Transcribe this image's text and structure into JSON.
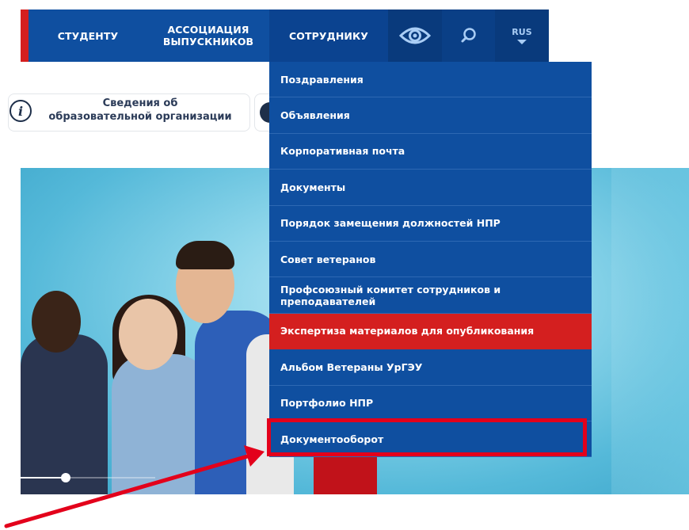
{
  "nav": {
    "student": "СТУДЕНТУ",
    "alumni_line1": "АССОЦИАЦИЯ",
    "alumni_line2": "ВЫПУСКНИКОВ",
    "staff": "СОТРУДНИКУ",
    "language": "RUS"
  },
  "info_button": {
    "line1": "Сведения об",
    "line2": "образовательной организации"
  },
  "dropdown": {
    "items": [
      {
        "label": "Поздравления"
      },
      {
        "label": "Объявления"
      },
      {
        "label": "Корпоративная почта"
      },
      {
        "label": "Документы"
      },
      {
        "label": "Порядок замещения должностей НПР"
      },
      {
        "label": "Совет ветеранов"
      },
      {
        "label": "Профсоюзный комитет сотрудников и преподавателей"
      },
      {
        "label": "Экспертиза материалов для опубликования"
      },
      {
        "label": "Альбом Ветераны УрГЭУ"
      },
      {
        "label": "Портфолио НПР"
      },
      {
        "label": "Документооборот"
      }
    ],
    "active_index": 7,
    "highlighted_index": 10
  },
  "colors": {
    "nav_blue": "#0f4fa0",
    "nav_dark": "#093a7c",
    "accent_red": "#d41f1f",
    "annotation_red": "#e3001b"
  },
  "icons": {
    "visibility": "eye-icon",
    "search": "search-icon",
    "language_caret": "caret-down-icon",
    "info": "info-icon"
  }
}
